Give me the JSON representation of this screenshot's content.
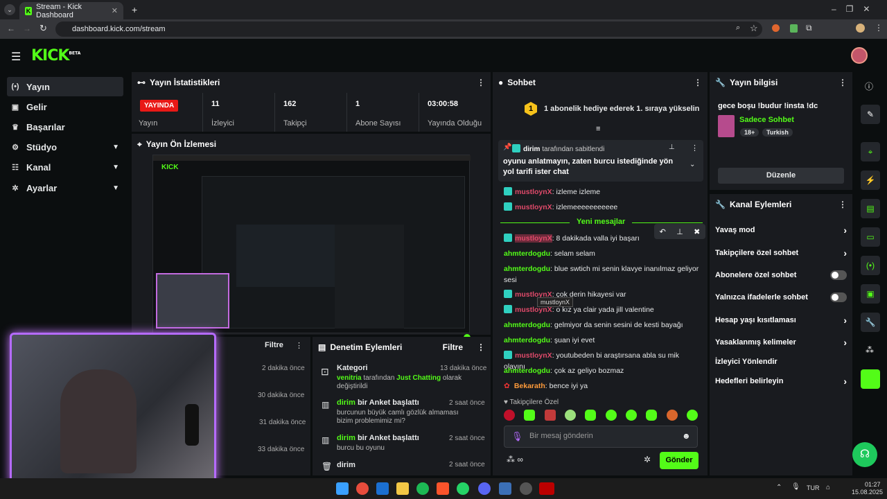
{
  "browser": {
    "tab_title": "Stream - Kick Dashboard",
    "url": "dashboard.kick.com/stream"
  },
  "brand": {
    "logo": "KICK",
    "beta": "BETA",
    "accent": "#53fc18"
  },
  "sidebar": {
    "items": [
      {
        "label": "Yayın",
        "icon": "broadcast-icon"
      },
      {
        "label": "Gelir",
        "icon": "revenue-icon"
      },
      {
        "label": "Başarılar",
        "icon": "trophy-icon"
      },
      {
        "label": "Stüdyo",
        "icon": "studio-icon"
      },
      {
        "label": "Kanal",
        "icon": "channel-icon"
      },
      {
        "label": "Ayarlar",
        "icon": "gear-icon"
      }
    ]
  },
  "stats": {
    "title": "Yayın İstatistikleri",
    "live": "YAYINDA",
    "live_label": "Yayın",
    "items": [
      {
        "value": "11",
        "label": "İzleyici"
      },
      {
        "value": "162",
        "label": "Takipçi"
      },
      {
        "value": "1",
        "label": "Abone Sayısı"
      },
      {
        "value": "03:00:58",
        "label": "Yayında Olduğu"
      }
    ]
  },
  "preview": {
    "title": "Yayın Ön İzlemesi"
  },
  "left_bottom": {
    "filter": "Filtre",
    "times": [
      "2 dakika önce",
      "30 dakika önce",
      "31 dakika önce",
      "33 dakika önce"
    ]
  },
  "moderation": {
    "title": "Denetim Eylemleri",
    "filter": "Filtre",
    "items": [
      {
        "title": "Kategori",
        "time": "13 dakika önce",
        "user": "venitria",
        "mid": " tarafından ",
        "cat": "Just Chatting",
        "tail": " olarak değiştirildi"
      },
      {
        "user": "dirim",
        "title": " bir Anket başlattı",
        "time": "2 saat önce",
        "desc": "burcunun büyük camlı gözlük almaması bizim problemimiz mi?"
      },
      {
        "user": "dirim",
        "title": " bir Anket başlattı",
        "time": "2 saat önce",
        "desc": "burcu bu oyunu"
      },
      {
        "title": "dirim",
        "time": "2 saat önce"
      }
    ]
  },
  "chat": {
    "title": "Sohbet",
    "gift_banner": "1 abonelik hediye ederek 1. sıraya yükselin",
    "gift_rank": "1",
    "pinned_by_user": "dirim",
    "pinned_by_text": " tarafından sabitlendi",
    "pinned_message": "oyunu anlatmayın, zaten burcu istediğinde yön yol tarifi ister chat",
    "new_messages": "Yeni mesajlar",
    "tooltip": "mustloynX",
    "messages": [
      {
        "user": "mustloynX",
        "text": ": izleme izleme",
        "color": "red"
      },
      {
        "user": "mustloynX",
        "text": ": izlemeeeeeeeeeee",
        "color": "red"
      },
      {
        "user": "mustloynX",
        "text": ": 8 dakikada valla iyi başarı",
        "color": "red"
      },
      {
        "user": "ahmterdogdu",
        "text": ": selam selam",
        "color": "green"
      },
      {
        "user": "ahmterdogdu",
        "text": ": blue swtich mi senin klavye inanılmaz geliyor sesi",
        "color": "green"
      },
      {
        "user": "mustloynX",
        "text": ": çok derin hikayesi var",
        "color": "red"
      },
      {
        "user": "mustloynX",
        "text": ": o kız ya clair yada jill valentine",
        "color": "red"
      },
      {
        "user": "ahmterdogdu",
        "text": ": gelmiyor da senin sesini de kesti bayağı",
        "color": "green"
      },
      {
        "user": "ahmterdogdu",
        "text": ": şuan iyi evet",
        "color": "green"
      },
      {
        "user": "mustloynX",
        "text": ": youtubeden bi araştırsana abla su mik olayını",
        "color": "red"
      },
      {
        "user": "ahmterdogdu",
        "text": ": çok az geliyo bozmaz",
        "color": "green"
      },
      {
        "user": "Bekarath",
        "text": ": bence iyi ya",
        "color": "orange"
      }
    ],
    "followers_only": "Takipçilere Özel",
    "input_placeholder": "Bir mesaj gönderin",
    "send": "Gönder"
  },
  "stream_info": {
    "title": "Yayın bilgisi",
    "stream_title": "gece boşu !budur !insta !dc",
    "category": "Sadece Sohbet",
    "tags": [
      "18+",
      "Turkish"
    ],
    "edit": "Düzenle"
  },
  "channel_actions": {
    "title": "Kanal Eylemleri",
    "items": [
      {
        "label": "Yavaş mod",
        "kind": "chevron"
      },
      {
        "label": "Takipçilere özel sohbet",
        "kind": "chevron"
      },
      {
        "label": "Abonelere özel sohbet",
        "kind": "toggle"
      },
      {
        "label": "Yalnızca ifadelerle sohbet",
        "kind": "toggle"
      },
      {
        "label": "Hesap yaşı kısıtlaması",
        "kind": "chevron"
      },
      {
        "label": "Yasaklanmış kelimeler",
        "kind": "chevron"
      },
      {
        "label": "İzleyici Yönlendir",
        "kind": "none"
      },
      {
        "label": "Hedefleri belirleyin",
        "kind": "chevron"
      }
    ]
  },
  "taskbar": {
    "lang": "TUR",
    "time": "01:27",
    "date": "15.08.2025"
  }
}
